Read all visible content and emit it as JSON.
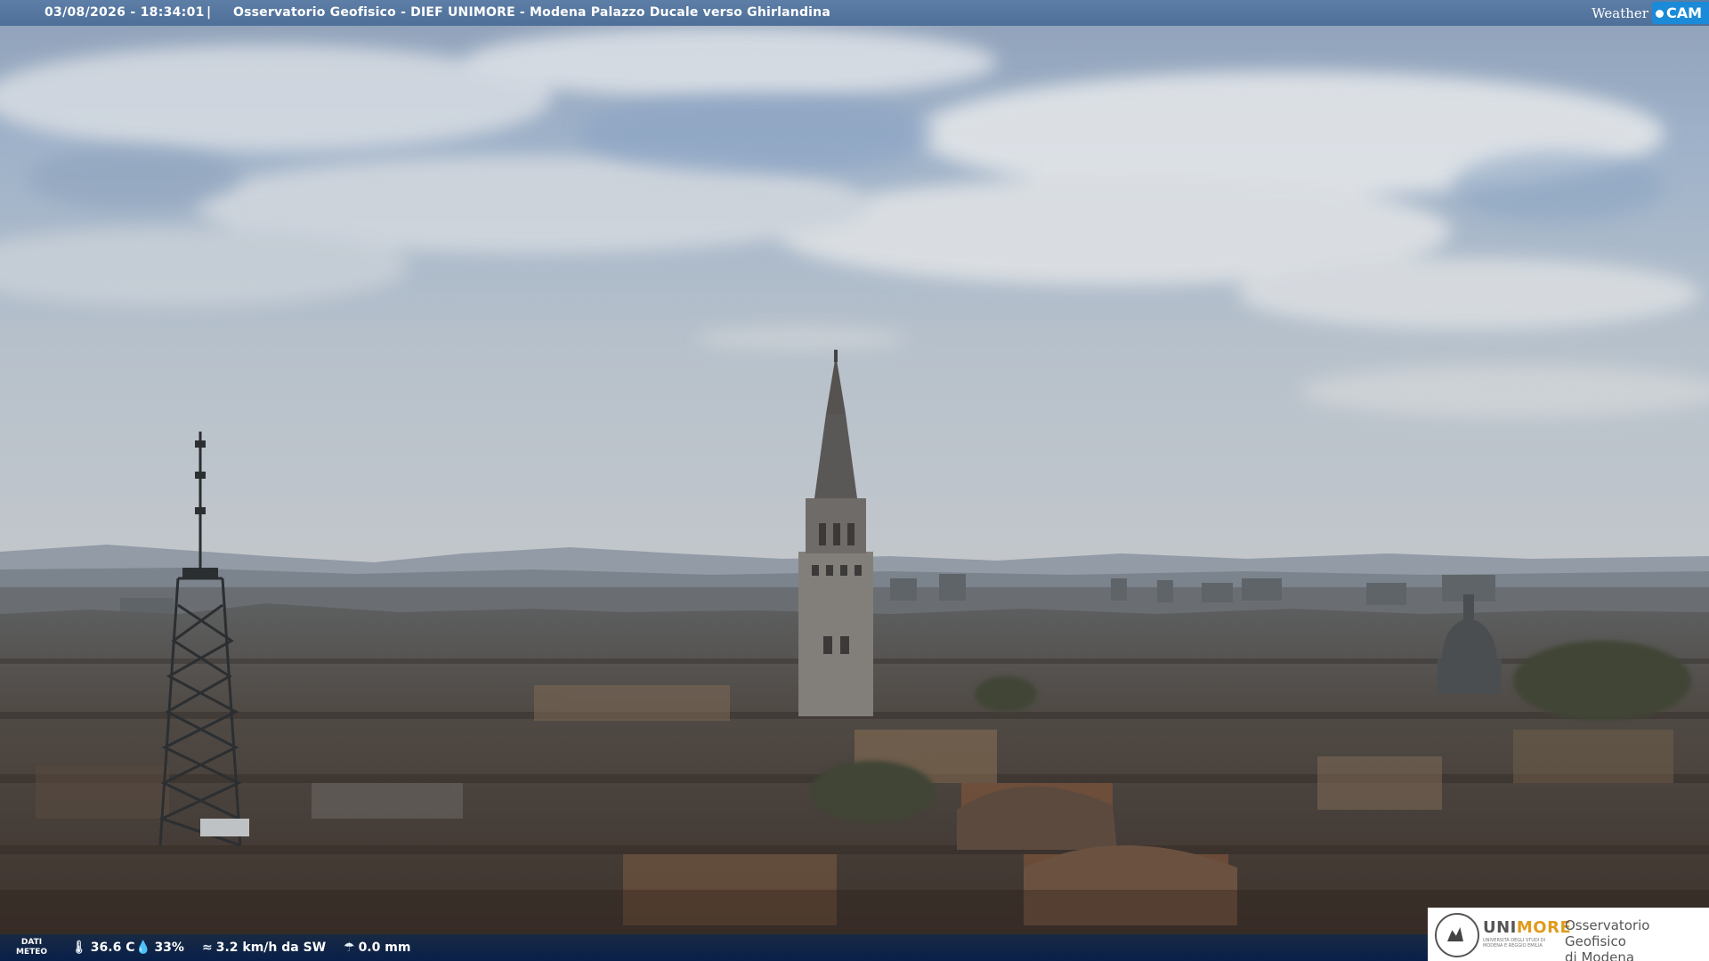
{
  "header": {
    "timestamp": "03/08/2026 - 18:34:01",
    "separator": "|",
    "title": "Osservatorio Geofisico - DIEF UNIMORE - Modena Palazzo Ducale verso Ghirlandina",
    "brand_weather": "Weather",
    "brand_cam": "CAM"
  },
  "weather_bar": {
    "label_line1": "DATI",
    "label_line2": "METEO",
    "temperature": "36.6 C",
    "humidity": "33%",
    "wind": "3.2 km/h da SW",
    "rain": "0.0 mm"
  },
  "logo": {
    "uni_prefix": "UNI",
    "uni_suffix": "MORE",
    "uni_sub": "UNIVERSITÀ DEGLI STUDI DI MODENA E REGGIO EMILIA",
    "observatory_line1": "Osservatorio Geofisico",
    "observatory_line2": "di Modena"
  },
  "colors": {
    "top_bar": "#5678a2",
    "bottom_bar": "#0b2f5c",
    "brand_cam": "#1b8ad8",
    "unimore_accent": "#e09b1c"
  },
  "icons": [
    "thermometer-icon",
    "humidity-drop-icon",
    "wind-icon",
    "rain-gauge-icon",
    "camera-icon"
  ]
}
